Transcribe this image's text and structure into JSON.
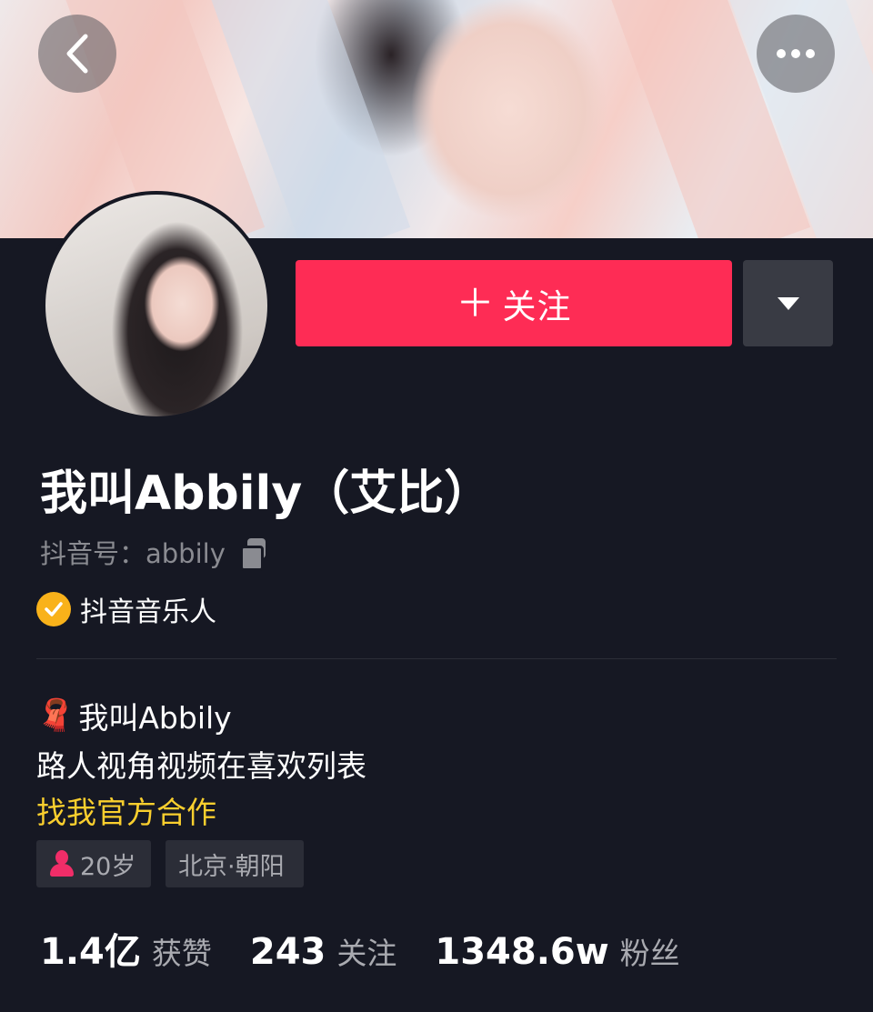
{
  "header": {
    "back_icon": "chevron-left-icon",
    "more_icon": "more-horizontal-icon"
  },
  "actions": {
    "follow_label": "关注",
    "follow_plus": "＋",
    "follow_color": "#fe2c55",
    "dropdown_icon": "triangle-down-icon"
  },
  "profile": {
    "name": "我叫Abbily（艾比）",
    "douyin_id": "抖音号：abbily",
    "verified_label": "抖音音乐人",
    "verified_color": "#f9b21a"
  },
  "bio": {
    "line1_emoji": "🧣",
    "line1": "我叫Abbily",
    "line2": "路人视角视频在喜欢列表",
    "line3": "找我官方合作",
    "line3_color": "#facf2e"
  },
  "tags": {
    "age": "20岁",
    "location": "北京·朝阳"
  },
  "stats": {
    "likes_num": "1.4亿",
    "likes_label": "获赞",
    "following_num": "243",
    "following_label": "关注",
    "fans_num": "1348.6w",
    "fans_label": "粉丝"
  }
}
